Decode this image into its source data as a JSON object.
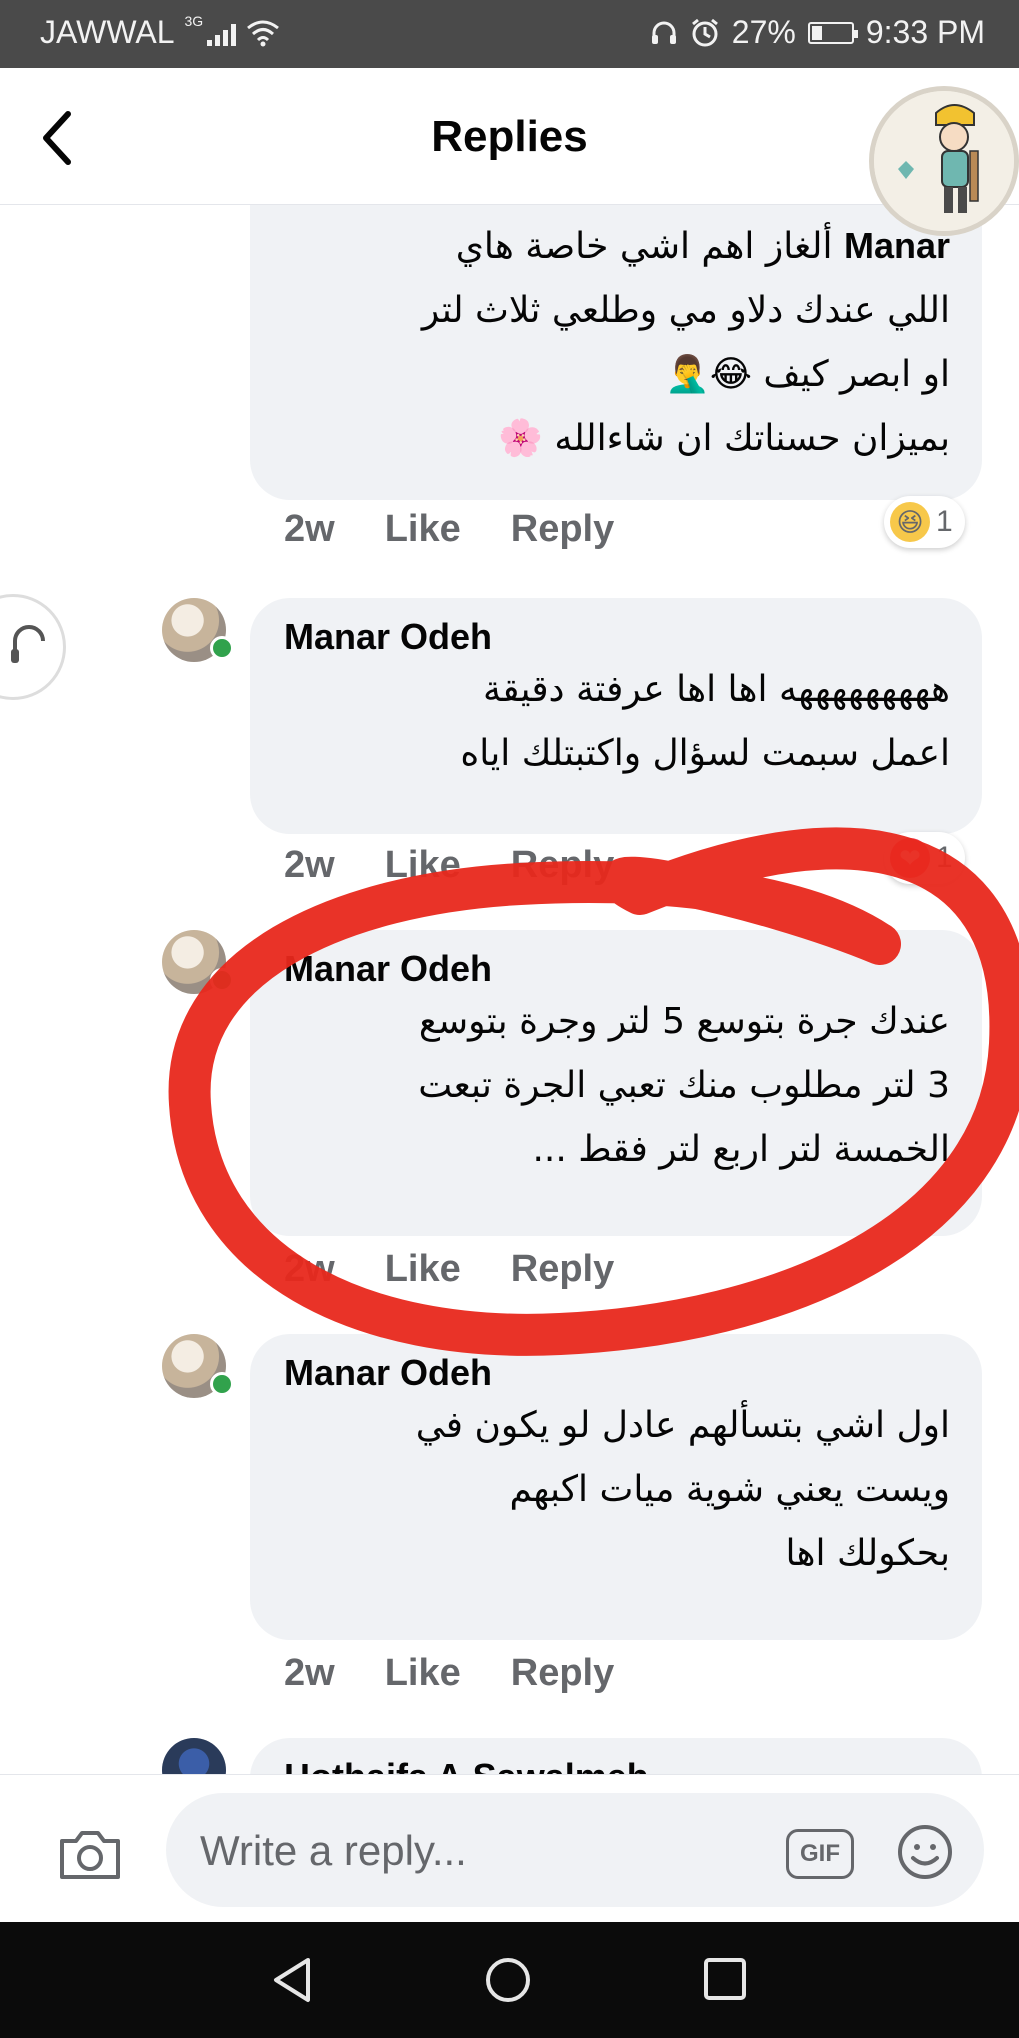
{
  "status_bar": {
    "carrier": "JAWWAL",
    "network": "3G",
    "battery": "27%",
    "battery_level": 0.27,
    "time": "9:33 PM"
  },
  "header": {
    "title": "Replies"
  },
  "comments": [
    {
      "name": "Manar",
      "lines": [
        "ألغاز اهم اشي خاصة هاي",
        "اللي عندك دلاو مي وطلعي ثلاث لتر",
        "او ابصر كيف 😂🤦‍♂️",
        "بميزان حسناتك ان شاءالله 🌸"
      ],
      "time": "2w",
      "like": "Like",
      "reply": "Reply",
      "reaction": {
        "icon": "😆",
        "count": "1"
      }
    },
    {
      "name": "Manar Odeh",
      "lines": [
        "هههههههههه اها اها عرفتة دقيقة",
        "اعمل سبمت لسؤال واكتبتلك اياه"
      ],
      "time": "2w",
      "like": "Like",
      "reply": "Reply",
      "reaction": {
        "icon": "❤",
        "count": "1"
      }
    },
    {
      "name": "Manar Odeh",
      "lines": [
        "عندك جرة بتوسع 5 لتر وجرة بتوسع",
        "3 لتر مطلوب منك تعبي الجرة تبعت",
        "الخمسة لتر اربع لتر فقط ..."
      ],
      "time": "2w",
      "like": "Like",
      "reply": "Reply"
    },
    {
      "name": "Manar Odeh",
      "lines": [
        "اول اشي بتسألهم عادل لو يكون في",
        "ويست يعني شوية ميات اكبهم",
        "بحكولك اها"
      ],
      "time": "2w",
      "like": "Like",
      "reply": "Reply"
    },
    {
      "name": "Hothaifa A.Sawalmeh"
    }
  ],
  "composer": {
    "placeholder": "Write a reply...",
    "gif_label": "GIF"
  },
  "colors": {
    "bubble": "#f0f2f5",
    "meta": "#65676b",
    "annotation": "#e8281c",
    "online": "#31a24c"
  }
}
